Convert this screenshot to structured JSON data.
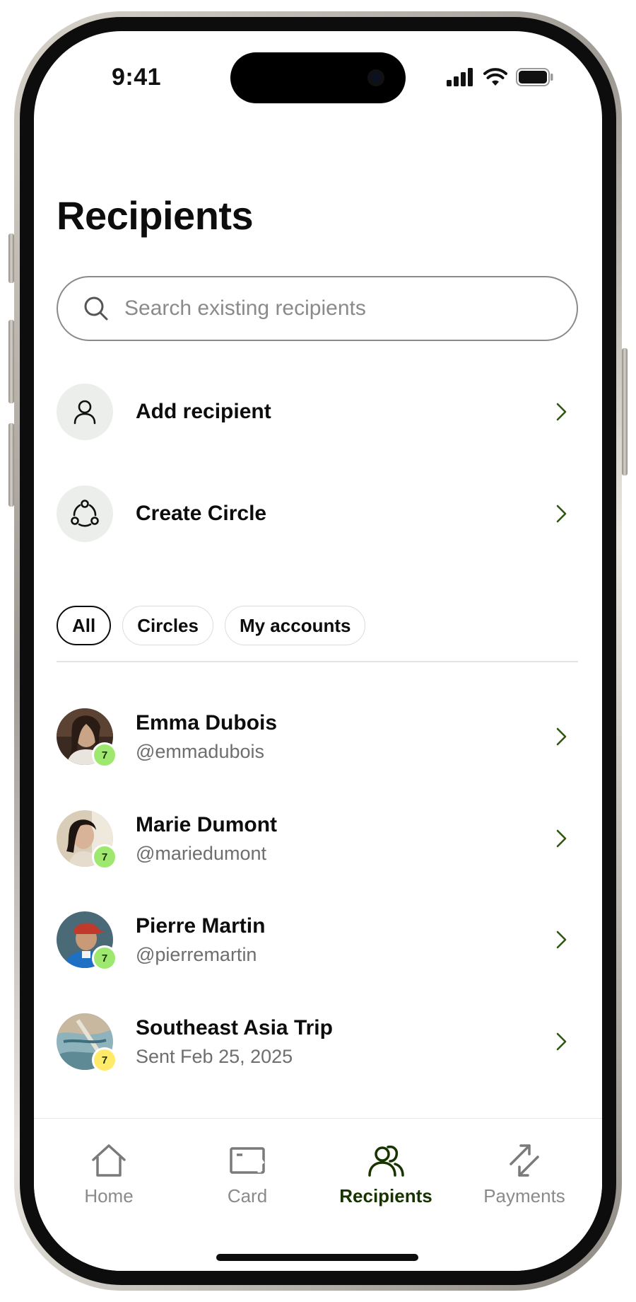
{
  "status_bar": {
    "time": "9:41",
    "icons": [
      "signal-icon",
      "wifi-icon",
      "battery-icon"
    ]
  },
  "page": {
    "title": "Recipients"
  },
  "search": {
    "placeholder": "Search existing recipients",
    "icon": "search-icon"
  },
  "actions": [
    {
      "label": "Add recipient",
      "icon": "person-icon"
    },
    {
      "label": "Create Circle",
      "icon": "circle-group-icon"
    }
  ],
  "filters": {
    "items": [
      "All",
      "Circles",
      "My accounts"
    ],
    "selected": "All"
  },
  "recipients": [
    {
      "name": "Emma Dubois",
      "sub": "@emmadubois",
      "badge": "7"
    },
    {
      "name": "Marie Dumont",
      "sub": "@mariedumont",
      "badge": "7"
    },
    {
      "name": "Pierre Martin",
      "sub": "@pierremartin",
      "badge": "7"
    },
    {
      "name": "Southeast Asia Trip",
      "sub": "Sent Feb 25, 2025",
      "badge": "7"
    }
  ],
  "tab_bar": {
    "items": [
      {
        "label": "Home",
        "icon": "home-icon"
      },
      {
        "label": "Card",
        "icon": "card-icon"
      },
      {
        "label": "Recipients",
        "icon": "recipients-icon"
      },
      {
        "label": "Payments",
        "icon": "payments-icon"
      }
    ],
    "active": "Recipients"
  },
  "colors": {
    "accent_dark_green": "#163300",
    "badge_green": "#9fe870",
    "badge_yellow": "#ffeb69",
    "chevron_green": "#2f5711"
  }
}
